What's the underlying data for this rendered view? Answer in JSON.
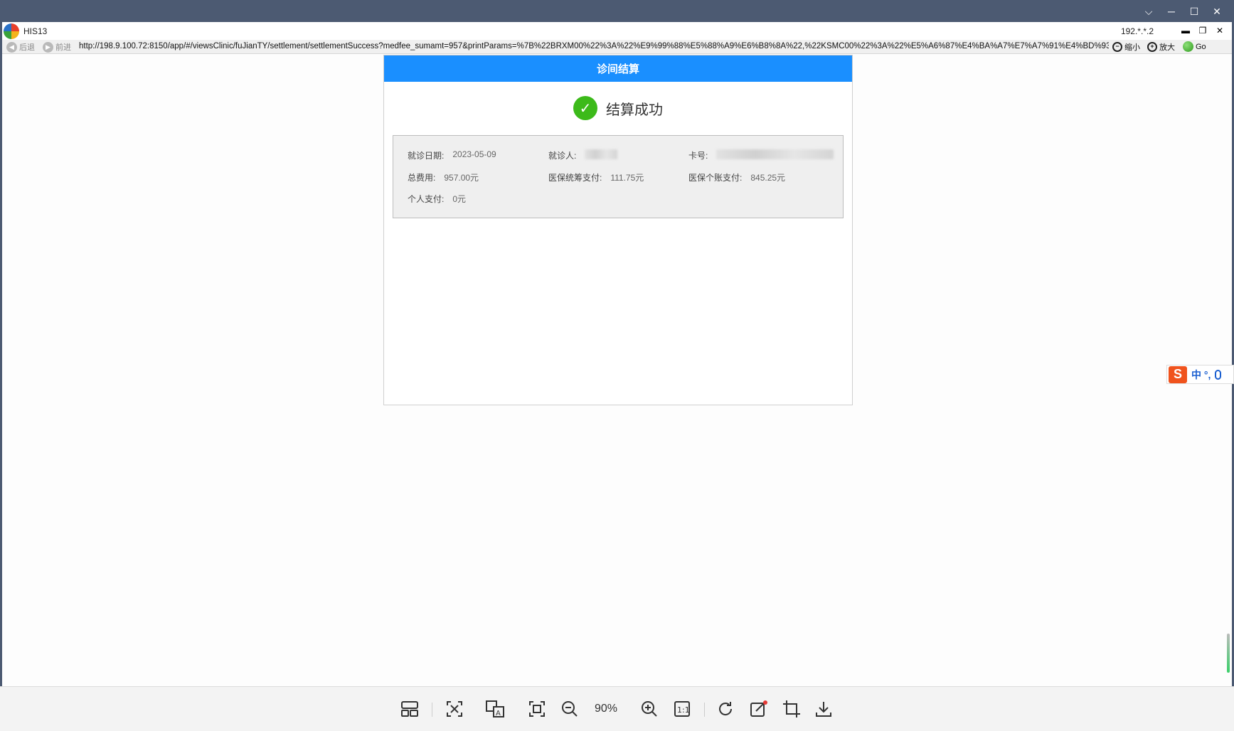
{
  "viewer": {
    "controls": [
      "⌵",
      "─",
      "☐",
      "✕"
    ]
  },
  "app": {
    "title": "HIS13",
    "ip": "192.*.*.2",
    "controls": [
      "▬",
      "❐",
      "✕"
    ]
  },
  "addressbar": {
    "back_label": "后退",
    "forward_label": "前进",
    "url": "http://198.9.100.72:8150/app/#/viewsClinic/fuJianTY/settlement/settlementSuccess?medfee_sumamt=957&printParams=%7B%22BRXM00%22%3A%22%E9%99%88%E5%88%A9%E6%B8%8A%22,%22KSMC00%22%3A%22%E5%A6%87%E4%BA%A7%E7%A7%91%E4%BD%93E",
    "zoom_out_label": "缩小",
    "zoom_in_label": "放大",
    "go_label": "Go"
  },
  "dialog": {
    "title": "诊间结算",
    "success_text": "结算成功",
    "fields": {
      "visit_date_label": "就诊日期:",
      "visit_date_value": "2023-05-09",
      "patient_label": "就诊人:",
      "card_label": "卡号:",
      "total_label": "总费用:",
      "total_value": "957.00元",
      "pool_label": "医保统筹支付:",
      "pool_value": "111.75元",
      "account_label": "医保个账支付:",
      "account_value": "845.25元",
      "personal_label": "个人支付:",
      "personal_value": "0元"
    }
  },
  "ime": {
    "logo": "S",
    "text": "中 °,"
  },
  "toolbar": {
    "zoom_level": "90%"
  }
}
